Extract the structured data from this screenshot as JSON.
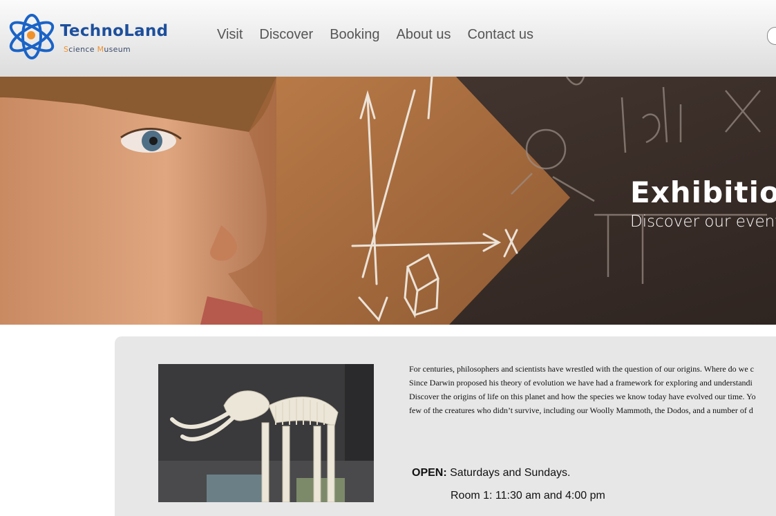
{
  "logo": {
    "title": "TechnoLand",
    "subtitle_1_accent": "S",
    "subtitle_1_rest": "cience ",
    "subtitle_2_accent": "M",
    "subtitle_2_rest": "useum"
  },
  "nav": {
    "items": [
      {
        "label": "Visit"
      },
      {
        "label": "Discover"
      },
      {
        "label": "Booking"
      },
      {
        "label": "About us"
      },
      {
        "label": "Contact us"
      }
    ]
  },
  "hero": {
    "title": "Exhibition",
    "subtitle": "Discover our events"
  },
  "content": {
    "description_lines": [
      "For centuries, philosophers and scientists have wrestled with the question of our origins. Where do we c",
      "Since Darwin proposed his theory of evolution we have had a framework for exploring and understandi",
      "Discover the origins of life on this planet and how the species we know today have evolved our time. Yo",
      "few of the creatures who didn’t survive, including our Woolly Mammoth, the Dodos, and a number of d"
    ],
    "open_label": "OPEN:",
    "open_text": " Saturdays and Sundays.",
    "room_text": "Room 1: 11:30 am and 4:00 pm"
  },
  "colors": {
    "brand_blue": "#1d4f9c",
    "brand_orange": "#f0922c",
    "hero_brown": "#a56a3c",
    "chalkboard": "#3d2f2a",
    "card_bg": "#e7e7e7"
  },
  "icons": {
    "logo": "atom-icon",
    "search": "search-icon"
  }
}
